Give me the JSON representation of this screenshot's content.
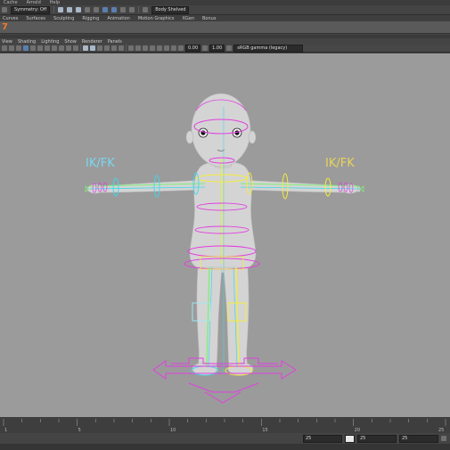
{
  "menubar": {
    "items": [
      "Cache",
      "Arnold",
      "Help"
    ]
  },
  "statusline": {
    "symmetry": "Symmetry: Off",
    "workspace": "Body Shelved"
  },
  "shelf_tabs": [
    "Curves",
    "Surfaces",
    "Sculpting",
    "Rigging",
    "Animation",
    "Motion Graphics",
    "XGen",
    "Bonus"
  ],
  "shelf": {
    "logo": "7"
  },
  "panel_menu": [
    "View",
    "Shading",
    "Lighting",
    "Show",
    "Renderer",
    "Panels"
  ],
  "panel_toolbar": {
    "value_a": "0.00",
    "value_b": "1.00",
    "colorspace": "sRGB gamma (legacy)"
  },
  "viewport": {
    "label_left": "IK/FK",
    "label_right": "IK/FK",
    "colors": {
      "background": "#9b9b9b",
      "ik_label": "#79d7ef",
      "fk_label": "#e9d45a",
      "control_magenta": "#e23fe0",
      "control_yellow": "#f5ec3a",
      "control_cyan": "#3fd8ec",
      "control_green": "#7cf07a"
    }
  },
  "timeline": {
    "ticks": [
      "1",
      "5",
      "10",
      "15",
      "20",
      "25"
    ]
  },
  "range": {
    "start_value": "25",
    "end_value": "25",
    "field_c": "25"
  }
}
